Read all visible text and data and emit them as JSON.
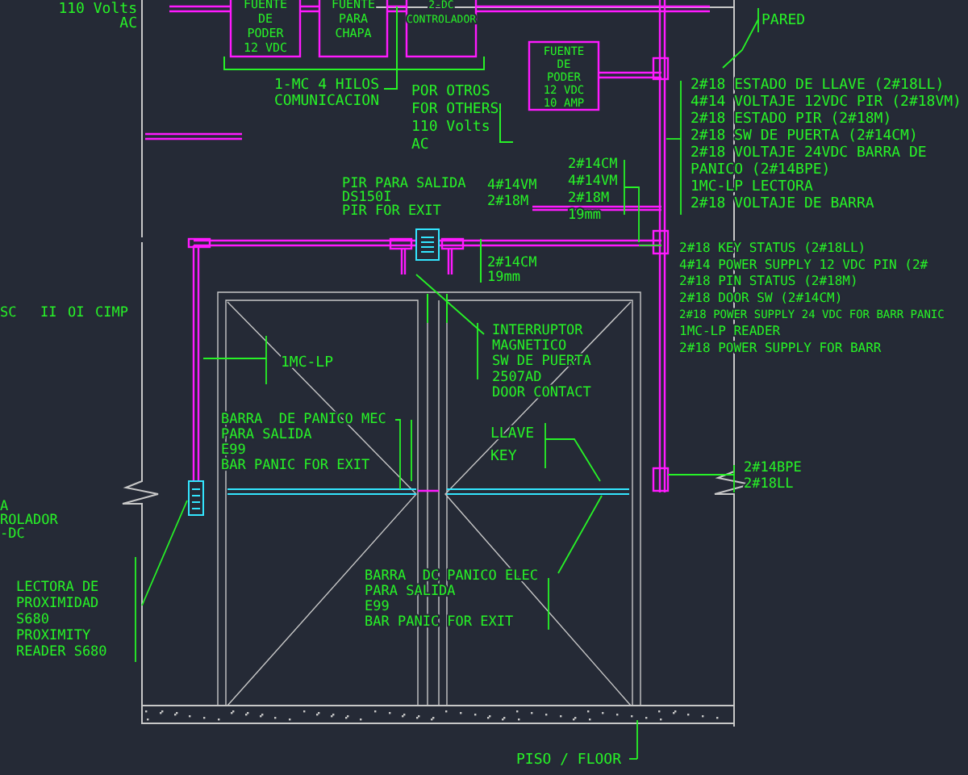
{
  "equipment_boxes": [
    {
      "lines": [
        "FUENTE",
        "DE",
        "PODER",
        "12 VDC"
      ]
    },
    {
      "lines": [
        "FUENTE",
        "PARA",
        "CHAPA"
      ]
    },
    {
      "lines": [
        "2-DC",
        "CONTROLADOR"
      ]
    },
    {
      "lines": [
        "FUENTE",
        "DE",
        "PODER",
        "12 VDC",
        "10 AMP"
      ]
    }
  ],
  "labels": [
    {
      "lines": [
        "110 Volts",
        "AC"
      ]
    },
    {
      "lines": [
        "1-MC 4 HILOS",
        "COMUNICACION"
      ]
    },
    {
      "lines": [
        "POR OTROS",
        "FOR OTHERS",
        "110 Volts",
        "AC"
      ]
    },
    {
      "lines": [
        "PARED"
      ]
    },
    {
      "lines": [
        "PIR PARA SALIDA",
        "DS150I",
        "PIR FOR EXIT"
      ]
    },
    {
      "lines": [
        "4#14VM",
        "2#18M"
      ]
    },
    {
      "lines": [
        "2#14CM",
        "4#14VM",
        "2#18M",
        "19mm"
      ]
    },
    {
      "lines": [
        "2#18 ESTADO DE LLAVE (2#18LL)",
        "4#14 VOLTAJE 12VDC PIR (2#18VM)",
        "2#18 ESTADO PIR (2#18M)",
        "2#18 SW DE PUERTA (2#14CM)",
        "2#18 VOLTAJE 24VDC BARRA DE",
        "PANICO (2#14BPE)",
        "1MC-LP LECTORA",
        "2#18 VOLTAJE DE BARRA"
      ]
    },
    {
      "lines": [
        "2#14CM",
        "19mm"
      ]
    },
    {
      "lines": [
        "2#18 KEY STATUS (2#18LL)",
        "4#14 POWER SUPPLY 12 VDC PIN (2#",
        "2#18 PIN STATUS (2#18M)",
        "2#18 DOOR SW (2#14CM)",
        "2#18 POWER SUPPLY 24 VDC FOR BARR PANIC",
        "1MC-LP READER",
        "2#18 POWER SUPPLY FOR BARR"
      ]
    },
    {
      "lines": [
        "SC"
      ]
    },
    {
      "lines": [
        "II"
      ]
    },
    {
      "lines": [
        "OI"
      ]
    },
    {
      "lines": [
        "CIMP"
      ]
    },
    {
      "lines": [
        "1MC-LP"
      ]
    },
    {
      "lines": [
        "INTERRUPTOR",
        "MAGNETICO",
        "SW DE PUERTA",
        "2507AD",
        "DOOR CONTACT"
      ]
    },
    {
      "lines": [
        "BARRA  DE PANICO MEC",
        "PARA SALIDA",
        "E99",
        "BAR PANIC FOR EXIT"
      ]
    },
    {
      "lines": [
        "LLAVE",
        "KEY"
      ]
    },
    {
      "lines": [
        "2#14BPE",
        "2#18LL"
      ]
    },
    {
      "lines": [
        "A",
        "ROLADOR",
        "-DC"
      ]
    },
    {
      "lines": [
        "LECTORA DE",
        "PROXIMIDAD",
        "S680",
        "PROXIMITY",
        "READER S680"
      ]
    },
    {
      "lines": [
        "BARRA  DC PANICO ELEC",
        "PARA SALIDA",
        "E99",
        "BAR PANIC FOR EXIT"
      ]
    },
    {
      "lines": [
        "PISO / FLOOR"
      ]
    }
  ]
}
